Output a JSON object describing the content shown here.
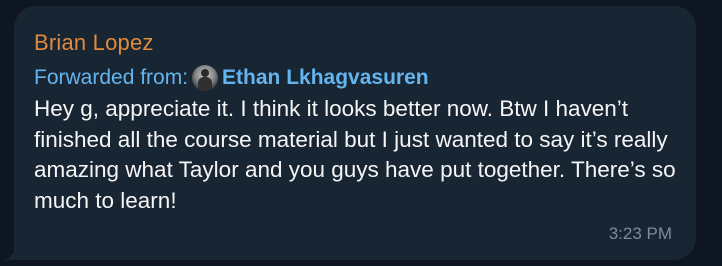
{
  "message": {
    "sender": "Brian Lopez",
    "forwarded_label": "Forwarded from:",
    "forwarded_from": "Ethan Lkhagvasuren",
    "text": "Hey g, appreciate it. I think it looks better now. Btw I haven’t finished all the course material but I just wanted to say it’s really amazing what Taylor and you guys have put together. There’s so much to learn!",
    "time": "3:23 PM"
  },
  "colors": {
    "background": "#0e1621",
    "bubble": "#182533",
    "sender": "#e08a3c",
    "forward": "#64b5ef",
    "text": "#f5f5f5",
    "time": "#7d8b99"
  }
}
